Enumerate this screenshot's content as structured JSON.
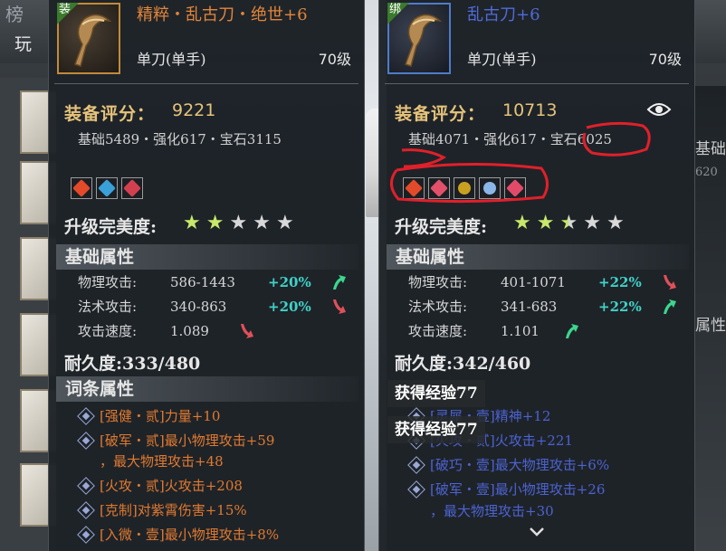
{
  "background": {
    "title": "榜",
    "play_label": "玩",
    "right_labels": [
      "基础",
      "属性"
    ],
    "right_numbers": [
      "620",
      "ㄴ"
    ]
  },
  "left_item": {
    "tag": "装",
    "name": "精粹・乱古刀・绝世+6",
    "type": "单刀(单手)",
    "level": "70级",
    "score_label": "装备评分：",
    "score": "9221",
    "breakdown": "基础5489・强化617・宝石3115",
    "gems": [
      "#e24a2a",
      "#3aa0d8",
      "#d24050"
    ],
    "upgrade_label": "升级完美度:",
    "stars": [
      "on",
      "on",
      "off",
      "off",
      "off"
    ],
    "base_header": "基础属性",
    "stats": [
      {
        "label": "物理攻击:",
        "value": "586-1443",
        "pct": "+20%",
        "dir": "up"
      },
      {
        "label": "法术攻击:",
        "value": "340-863",
        "pct": "+20%",
        "dir": "down"
      },
      {
        "label": "攻击速度:",
        "value": "1.089",
        "pct": "",
        "dir": "down"
      }
    ],
    "durability": "耐久度:333/480",
    "affix_header": "词条属性",
    "affixes": [
      "[强健・贰]力量+10",
      "[破军・贰]最小物理攻击+59",
      "，最大物理攻击+48",
      "[火攻・贰]火攻击+208",
      "[克制]对紫霄伤害+15%",
      "[入微・壹]最小物理攻击+8%"
    ]
  },
  "right_item": {
    "tag": "绑",
    "name": "乱古刀+6",
    "type": "单刀(单手)",
    "level": "70级",
    "score_label": "装备评分：",
    "score": "10713",
    "breakdown": "基础4071・强化617・宝石6025",
    "gems": [
      "#e24a2a",
      "#e2506a",
      "#c9a020",
      "#8ab6e8",
      "#e24a6a"
    ],
    "upgrade_label": "升级完美度:",
    "stars": [
      "on",
      "on",
      "half",
      "off",
      "off"
    ],
    "base_header": "基础属性",
    "stats": [
      {
        "label": "物理攻击:",
        "value": "401-1071",
        "pct": "+22%",
        "dir": "down"
      },
      {
        "label": "法术攻击:",
        "value": "341-683",
        "pct": "+22%",
        "dir": "up"
      },
      {
        "label": "攻击速度:",
        "value": "1.101",
        "pct": "",
        "dir": "up"
      }
    ],
    "durability": "耐久度:342/460",
    "affixes": [
      "[灵犀・壹]精神+12",
      "[火攻・贰]火攻击+221",
      "[破巧・壹]最大物理攻击+6%",
      "[破军・壹]最小物理攻击+26",
      "，最大物理攻击+30"
    ]
  },
  "toasts": [
    "获得经验77",
    "获得经验77"
  ],
  "colors": {
    "legendary_orange": "#e2853a",
    "rare_blue": "#4f6bd8",
    "score_gold": "#e6c37a",
    "pct_teal": "#3fd2c8",
    "arrow_up": "#3cd68c",
    "arrow_down": "#e0505a",
    "annotation_red": "#e0202a"
  }
}
